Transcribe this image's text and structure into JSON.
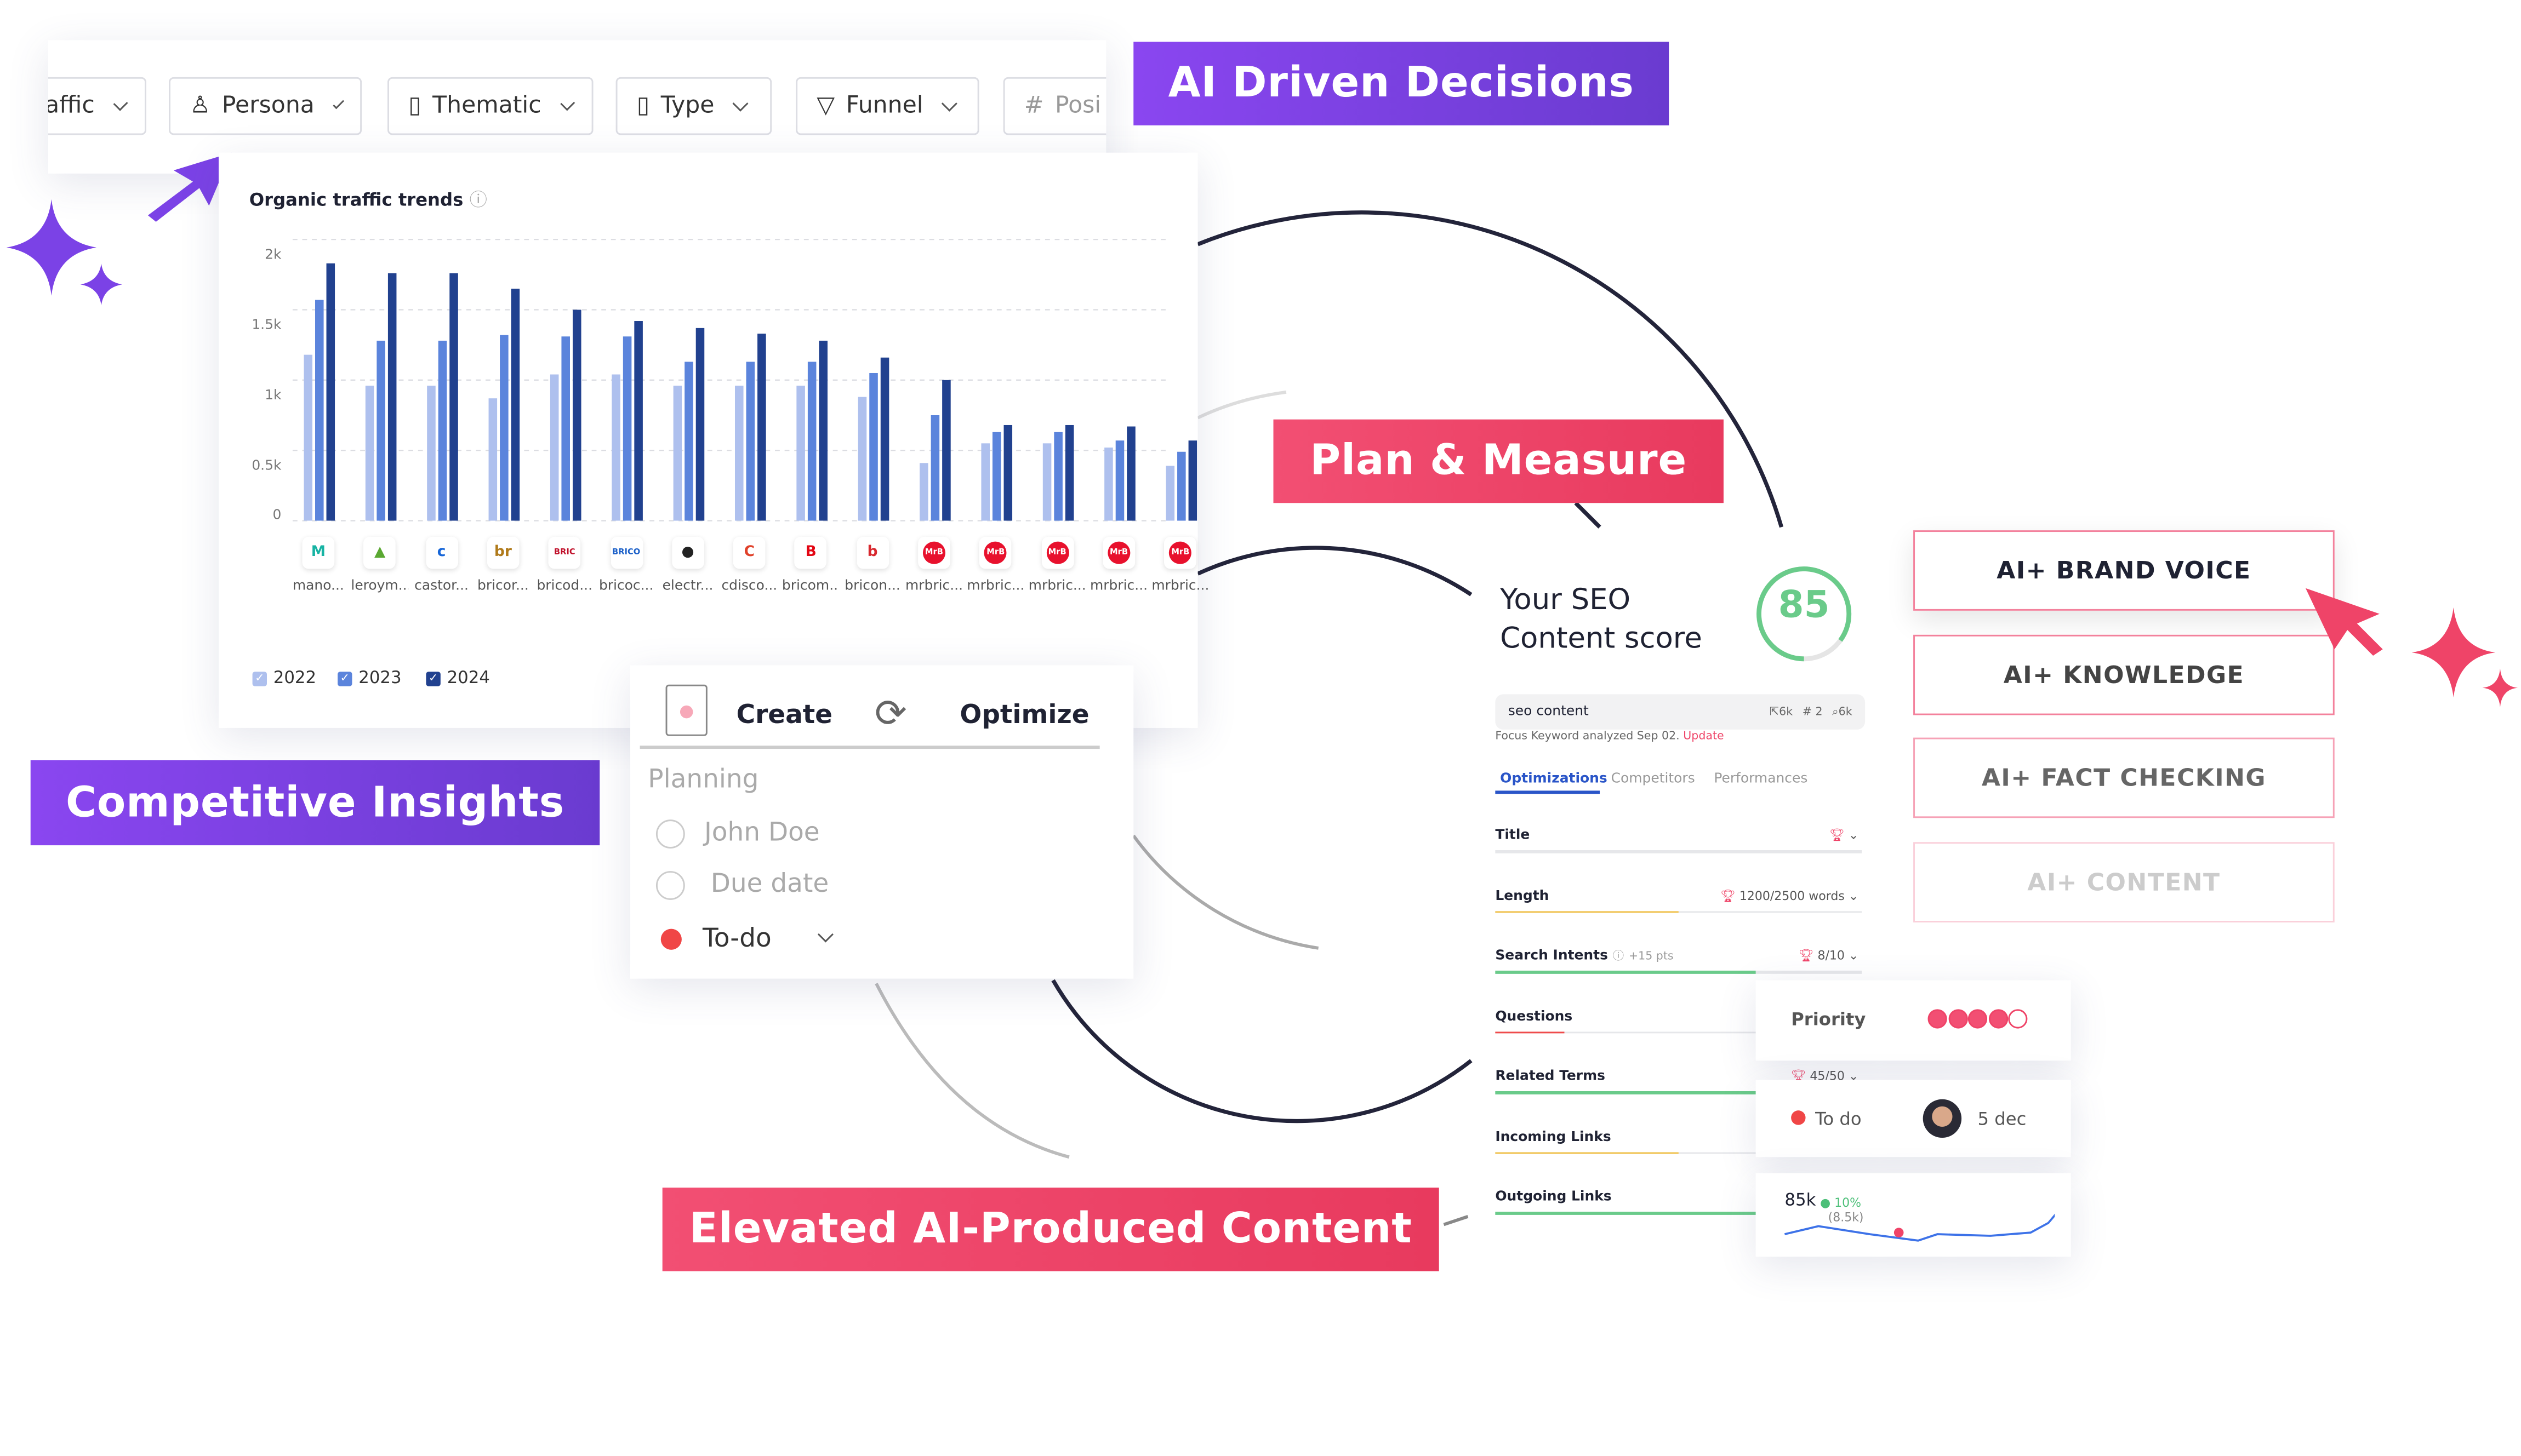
{
  "filters": [
    {
      "label": "affic",
      "icon": "chart-icon"
    },
    {
      "label": "Persona",
      "icon": "person-icon"
    },
    {
      "label": "Thematic",
      "icon": "bookmark-icon"
    },
    {
      "label": "Type",
      "icon": "file-icon"
    },
    {
      "label": "Funnel",
      "icon": "funnel-icon"
    },
    {
      "label": "Posi",
      "icon": "hash-icon"
    }
  ],
  "banners": {
    "ai_driven": "AI Driven Decisions",
    "plan_measure": "Plan & Measure",
    "competitive": "Competitive Insights",
    "elevated": "Elevated AI-Produced Content"
  },
  "colors": {
    "purple": "#7b42e6",
    "pink": "#ef4468",
    "bar_2022": "#aec0ee",
    "bar_2023": "#5b84dc",
    "bar_2024": "#21418f",
    "score_green": "#6acb8a"
  },
  "chart_data": {
    "type": "bar",
    "title": "Organic traffic trends",
    "categories": [
      "mano...",
      "leroym...",
      "castor...",
      "bricor...",
      "bricod...",
      "bricoc...",
      "electr...",
      "cdisco...",
      "bricom...",
      "bricon...",
      "mrbric...",
      "mrbric...",
      "mrbric...",
      "mrbric...",
      "mrbric..."
    ],
    "logo_text": [
      "M",
      "▲",
      "c",
      "br",
      "BRIC",
      "BRICO",
      "●",
      "C",
      "B",
      "b",
      "MrB",
      "MrB",
      "MrB",
      "MrB",
      "MrB"
    ],
    "series": [
      {
        "name": "2022",
        "values": [
          1180,
          960,
          960,
          870,
          1040,
          1040,
          960,
          960,
          960,
          880,
          410,
          550,
          550,
          520,
          390
        ]
      },
      {
        "name": "2023",
        "values": [
          1570,
          1280,
          1280,
          1320,
          1310,
          1310,
          1130,
          1130,
          1130,
          1050,
          750,
          630,
          630,
          570,
          490
        ]
      },
      {
        "name": "2024",
        "values": [
          1830,
          1760,
          1760,
          1650,
          1500,
          1420,
          1370,
          1330,
          1280,
          1160,
          1000,
          680,
          680,
          670,
          570
        ]
      }
    ],
    "yticks": [
      "0",
      "0.5k",
      "1k",
      "1.5k",
      "2k"
    ],
    "ylim": [
      0,
      2000
    ],
    "grid": true,
    "legend": "bottom-left"
  },
  "task": {
    "create": "Create",
    "optimize": "Optimize",
    "planning": "Planning",
    "assignee": "John Doe",
    "due": "Due date",
    "status": "To-do"
  },
  "seo": {
    "title": [
      "Your SEO",
      "Content score"
    ],
    "score": "85",
    "score_fraction": 0.85,
    "keyword": "seo content",
    "stat_clicks": "6k",
    "stat_rank": "# 2",
    "stat_search": "6k",
    "analyzed": "Focus Keyword analyzed Sep 02.",
    "update": "Update",
    "tabs": [
      "Optimizations",
      "Competitors",
      "Performances"
    ],
    "rows": [
      {
        "label": "Title",
        "value": "",
        "progress": 0,
        "color": "#e6e7ea"
      },
      {
        "label": "Length",
        "value": "1200/2500 words",
        "progress": 0.5,
        "color": "#f0c24f"
      },
      {
        "label": "Search Intents",
        "extra": "+15 pts",
        "value": "8/10",
        "progress": 0.71,
        "color": "#6acb8a"
      },
      {
        "label": "Questions",
        "value": "",
        "progress": 0.19,
        "color": "#ef4b4b"
      },
      {
        "label": "Related Terms",
        "value": "45/50",
        "progress": 0.9,
        "color": "#6acb8a"
      },
      {
        "label": "Incoming Links",
        "value": "",
        "progress": 0.5,
        "color": "#f0c24f"
      },
      {
        "label": "Outgoing Links",
        "value": "",
        "progress": 1,
        "color": "#6acb8a"
      }
    ]
  },
  "priority": {
    "label": "Priority",
    "level": 4,
    "max": 5
  },
  "todo": {
    "status": "To do",
    "date": "5 dec"
  },
  "traffic": {
    "value": "85k",
    "change": "10%",
    "delta": "(8.5k)"
  },
  "ai_buttons": [
    "AI+ BRAND VOICE",
    "AI+ KNOWLEDGE",
    "AI+ FACT CHECKING",
    "AI+ CONTENT"
  ]
}
